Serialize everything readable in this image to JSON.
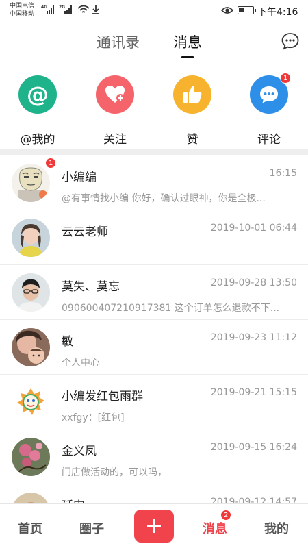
{
  "status_bar": {
    "carrier_1": "中国电信",
    "carrier_2": "中国移动",
    "net_1": "4G",
    "net_2": "2G",
    "time": "下午4:16"
  },
  "header": {
    "tabs": [
      {
        "label": "通讯录",
        "active": false
      },
      {
        "label": "消息",
        "active": true
      }
    ],
    "chat_icon": "chat-bubble-icon"
  },
  "actions": [
    {
      "label": "@我的",
      "icon": "at-icon",
      "color": "#1fb38c",
      "glyph": "@"
    },
    {
      "label": "关注",
      "icon": "heart-plus-icon",
      "color": "#f4646a"
    },
    {
      "label": "赞",
      "icon": "thumbs-up-icon",
      "color": "#f7b32d"
    },
    {
      "label": "评论",
      "icon": "comment-icon",
      "color": "#2e8fe8",
      "badge": "1"
    }
  ],
  "messages": [
    {
      "name": "小编编",
      "time": "16:15",
      "preview": "@有事情找小编 你好，确认过眼神，你是全极...",
      "badge": "1"
    },
    {
      "name": "云云老师",
      "time": "2019-10-01 06:44",
      "preview": ""
    },
    {
      "name": "莫失、莫忘",
      "time": "2019-09-28 13:50",
      "preview": "090600407210917381  这个订单怎么退款不下..."
    },
    {
      "name": "敏",
      "time": "2019-09-23 11:12",
      "preview": "个人中心"
    },
    {
      "name": "小编发红包雨群",
      "time": "2019-09-21 15:15",
      "preview": "xxfgy：[红包]"
    },
    {
      "name": "金义凤",
      "time": "2019-09-15 16:24",
      "preview": "门店做活动的，可以吗，"
    },
    {
      "name": "延安",
      "time": "2019-09-12 14:57",
      "preview": ""
    }
  ],
  "bottom_nav": {
    "home": "首页",
    "circle": "圈子",
    "add_icon": "plus-icon",
    "messages": "消息",
    "messages_badge": "2",
    "mine": "我的"
  },
  "colors": {
    "accent": "#f0434b",
    "badge": "#f03a3a"
  }
}
